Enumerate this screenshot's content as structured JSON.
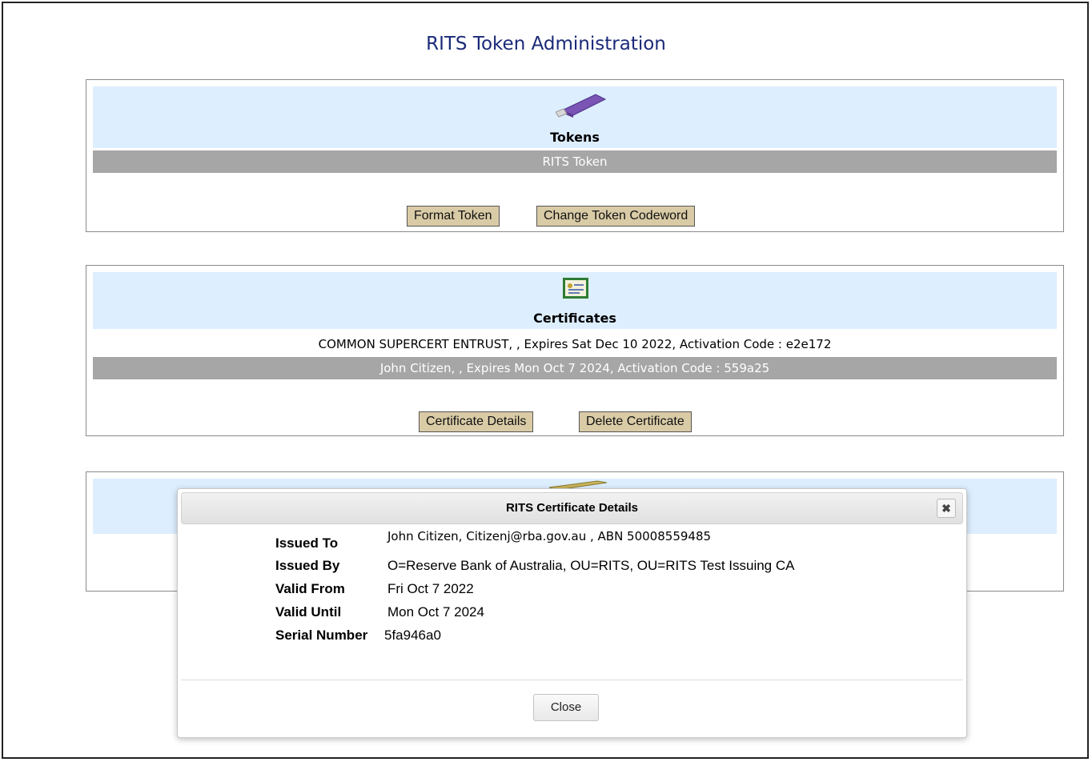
{
  "page": {
    "title": "RITS Token Administration"
  },
  "tokens_panel": {
    "title": "Tokens",
    "icon": "usb-token-icon",
    "items": [
      "RITS Token"
    ],
    "selected_index": 0,
    "buttons": {
      "format": "Format Token",
      "change_codeword": "Change Token Codeword"
    }
  },
  "certificates_panel": {
    "title": "Certificates",
    "icon": "certificate-icon",
    "items": [
      "COMMON SUPERCERT ENTRUST, , Expires Sat Dec 10 2022, Activation Code : e2e172",
      "John Citizen, , Expires Mon Oct 7 2024, Activation Code : 559a25"
    ],
    "selected_index": 1,
    "buttons": {
      "details": "Certificate Details",
      "delete": "Delete Certificate"
    }
  },
  "third_panel": {
    "icon": "pen-icon"
  },
  "modal": {
    "title": "RITS Certificate Details",
    "close_icon": "close-icon",
    "fields": [
      {
        "label": "Issued To",
        "value": "John Citizen, Citizenj@rba.gov.au , ABN 50008559485"
      },
      {
        "label": "Issued By",
        "value": "O=Reserve Bank of Australia, OU=RITS, OU=RITS Test Issuing CA"
      },
      {
        "label": "Valid From",
        "value": "Fri Oct 7 2022"
      },
      {
        "label": "Valid Until",
        "value": "Mon Oct 7 2024"
      },
      {
        "label": "Serial Number",
        "value": "5fa946a0"
      }
    ],
    "close_label": "Close"
  },
  "colors": {
    "title_blue": "#1a2a78",
    "panel_header": "#ddeeff",
    "selected_row": "#a6a6a6",
    "button_tan": "#d9cba6"
  }
}
